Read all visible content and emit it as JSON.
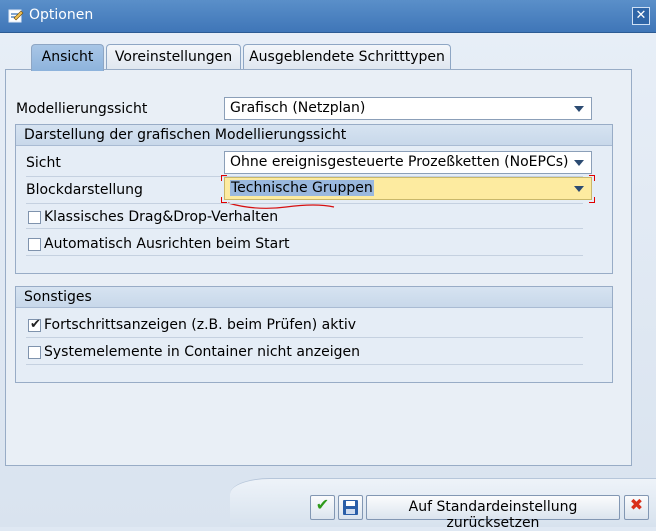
{
  "window": {
    "title": "Optionen",
    "close_glyph": "✕",
    "title_icon": "options-dialog-icon"
  },
  "tabs": [
    {
      "label": "Ansicht",
      "active": true
    },
    {
      "label": "Voreinstellungen",
      "active": false
    },
    {
      "label": "Ausgeblendete Schritttypen",
      "active": false
    }
  ],
  "fields": {
    "modellierungssicht": {
      "label": "Modellierungssicht",
      "value": "Grafisch (Netzplan)"
    }
  },
  "group_grafisch": {
    "header": "Darstellung der grafischen Modellierungssicht",
    "sicht": {
      "label": "Sicht",
      "value": "Ohne ereignisgesteuerte Prozeßketten (NoEPCs)"
    },
    "blockdarstellung": {
      "label": "Blockdarstellung",
      "value": "Technische Gruppen"
    },
    "checkboxes": [
      {
        "label": "Klassisches Drag&Drop-Verhalten",
        "checked": false
      },
      {
        "label": "Automatisch Ausrichten beim Start",
        "checked": false
      }
    ]
  },
  "group_sonstiges": {
    "header": "Sonstiges",
    "checkboxes": [
      {
        "label": "Fortschrittsanzeigen (z.B. beim Prüfen) aktiv",
        "checked": true
      },
      {
        "label": "Systemelemente in Container nicht anzeigen",
        "checked": false
      }
    ]
  },
  "buttons": {
    "confirm_icon": "check-icon",
    "confirm_glyph": "✔",
    "save_icon": "save-icon",
    "reset_label": "Auf Standardeinstellung zurücksetzen",
    "cancel_icon": "cancel-icon",
    "cancel_glyph": "✖"
  },
  "colors": {
    "titlebar": "#3f76b8",
    "focus_field": "#fdeba0",
    "confirm": "#2f9a1b",
    "cancel": "#d9301a"
  },
  "checkmark_glyph": "✔"
}
